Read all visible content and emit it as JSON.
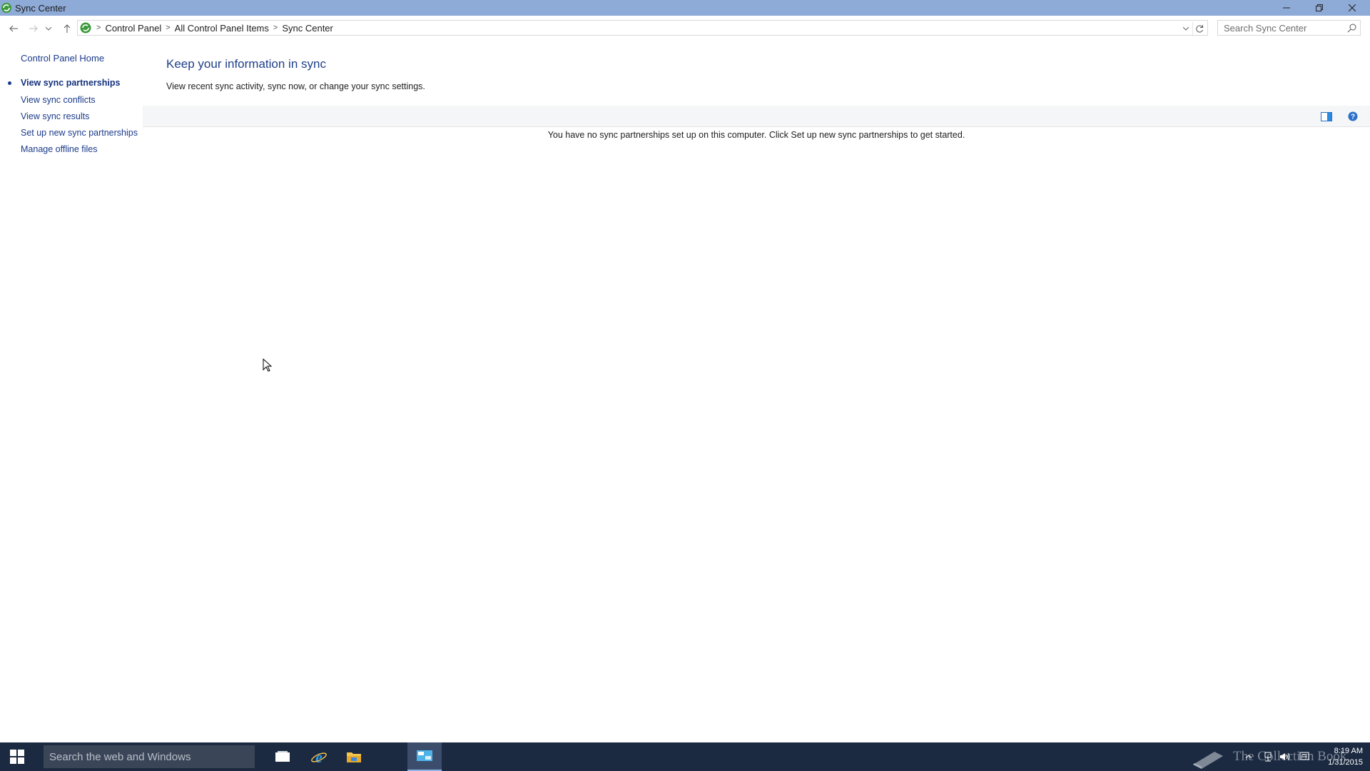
{
  "window": {
    "title": "Sync Center"
  },
  "address_bar": {
    "breadcrumbs": [
      "Control Panel",
      "All Control Panel Items",
      "Sync Center"
    ],
    "search_placeholder": "Search Sync Center"
  },
  "sidebar": {
    "home": "Control Panel Home",
    "items": [
      {
        "label": "View sync partnerships",
        "active": true
      },
      {
        "label": "View sync conflicts",
        "active": false
      },
      {
        "label": "View sync results",
        "active": false
      },
      {
        "label": "Set up new sync partnerships",
        "active": false
      },
      {
        "label": "Manage offline files",
        "active": false
      }
    ]
  },
  "main": {
    "heading": "Keep your information in sync",
    "subtitle": "View recent sync activity, sync now, or change your sync settings.",
    "empty_message": "You have no sync partnerships set up on this computer. Click Set up new sync partnerships to get started."
  },
  "taskbar": {
    "search_placeholder": "Search the web and Windows",
    "watermark": "The Collection Book",
    "time": "8:19 AM",
    "date": "1/31/2015"
  },
  "colors": {
    "titlebar": "#8eaad6",
    "link": "#1a3a8a",
    "heading": "#1e3f8a",
    "taskbar": "#1b2a41"
  }
}
